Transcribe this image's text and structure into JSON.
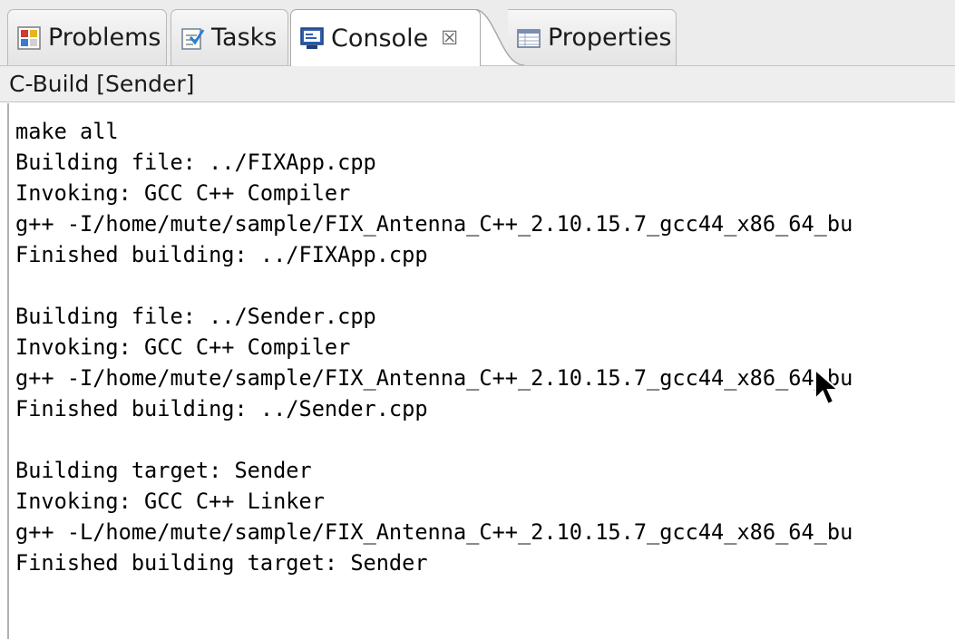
{
  "tabs": [
    {
      "label": "Problems",
      "icon": "problems-icon"
    },
    {
      "label": "Tasks",
      "icon": "tasks-icon"
    },
    {
      "label": "Console",
      "icon": "console-icon",
      "active": true,
      "close": "☒"
    },
    {
      "label": "Properties",
      "icon": "properties-icon"
    }
  ],
  "console": {
    "title": "C-Build [Sender]",
    "lines": [
      "make all",
      "Building file: ../FIXApp.cpp",
      "Invoking: GCC C++ Compiler",
      "g++ -I/home/mute/sample/FIX_Antenna_C++_2.10.15.7_gcc44_x86_64_bu",
      "Finished building: ../FIXApp.cpp",
      "",
      "Building file: ../Sender.cpp",
      "Invoking: GCC C++ Compiler",
      "g++ -I/home/mute/sample/FIX_Antenna_C++_2.10.15.7_gcc44_x86_64_bu",
      "Finished building: ../Sender.cpp",
      "",
      "Building target: Sender",
      "Invoking: GCC C++ Linker",
      "g++ -L/home/mute/sample/FIX_Antenna_C++_2.10.15.7_gcc44_x86_64_bu",
      "Finished building target: Sender"
    ]
  }
}
